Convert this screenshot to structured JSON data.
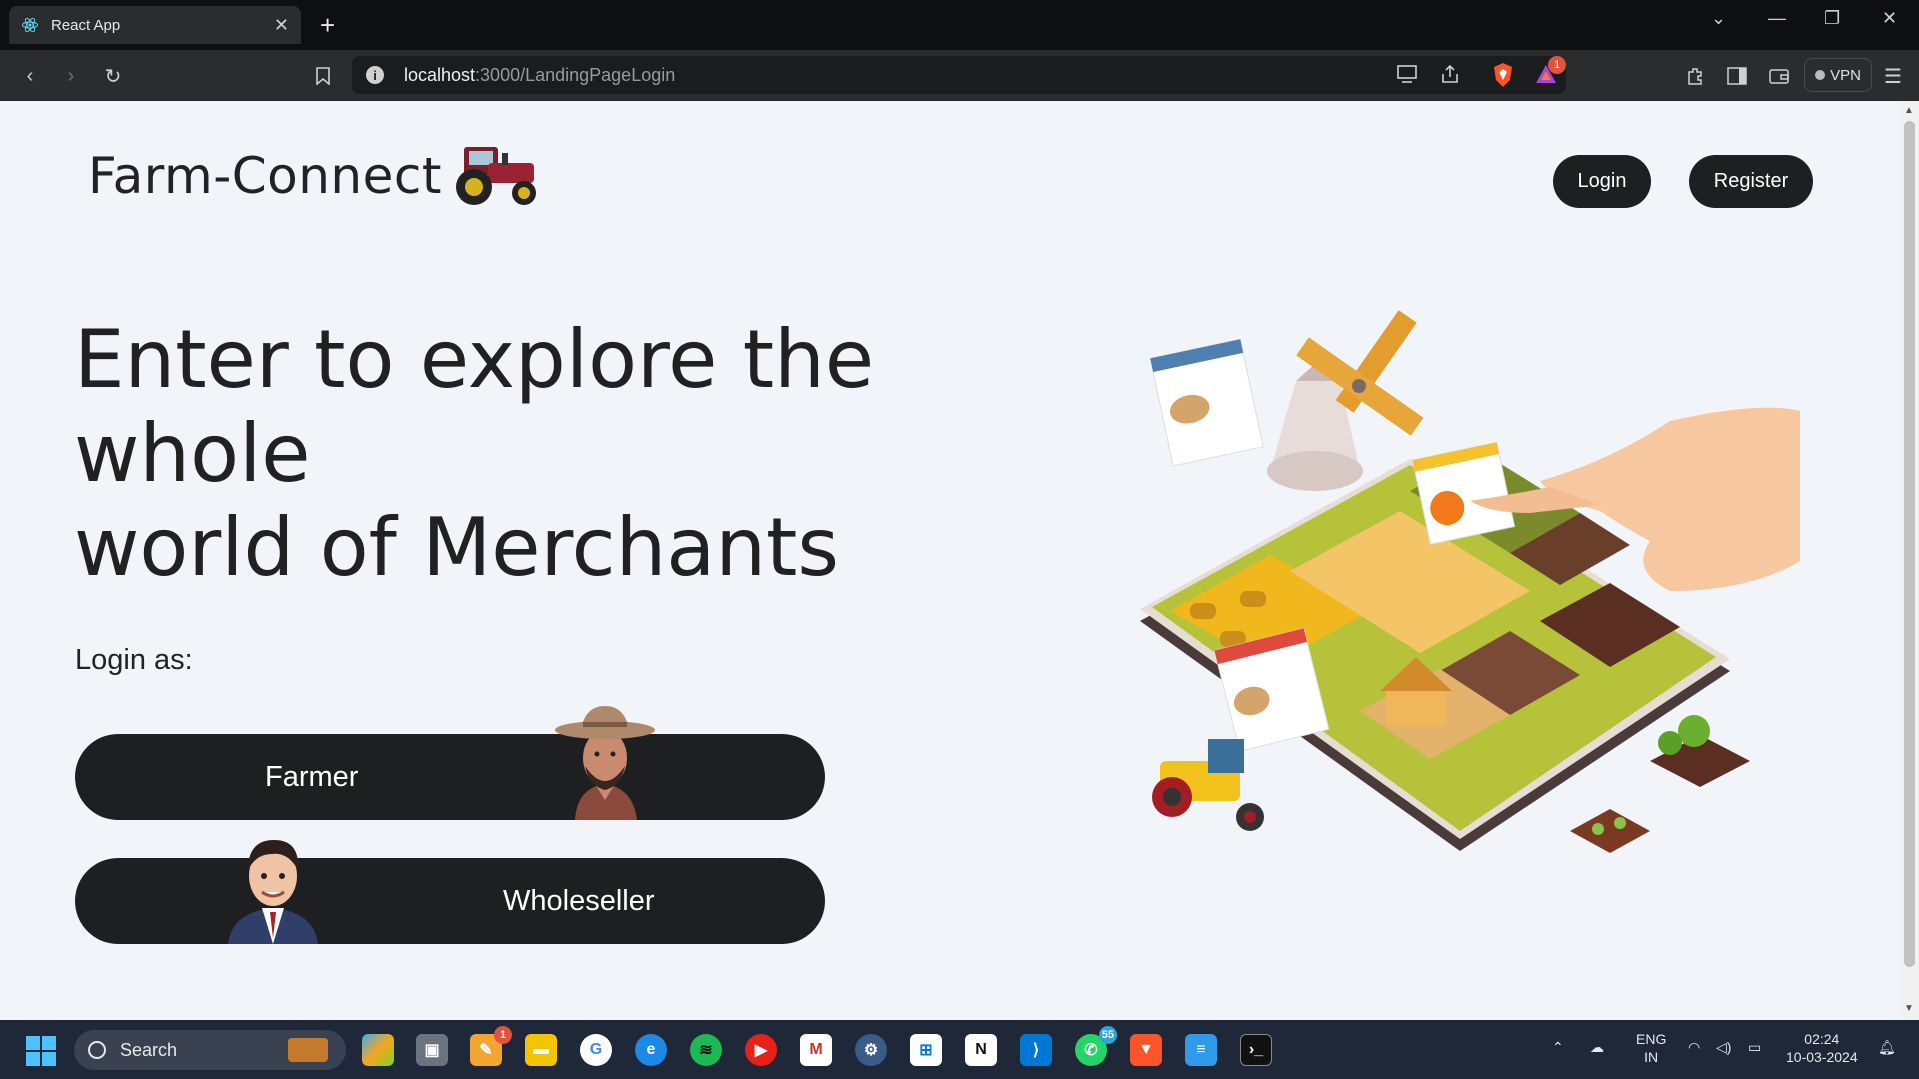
{
  "browser": {
    "tab_title": "React App",
    "url_host": "localhost",
    "url_path": ":3000/LandingPageLogin",
    "vpn_label": "VPN",
    "shield_badge": "1"
  },
  "page": {
    "brand": "Farm-Connect",
    "nav": {
      "login": "Login",
      "register": "Register"
    },
    "hero_line1": "Enter to explore the whole",
    "hero_line2": "world of Merchants",
    "login_as": "Login as:",
    "roles": {
      "farmer": "Farmer",
      "wholeseller": "Wholeseller"
    }
  },
  "taskbar": {
    "search_label": "Search",
    "lang_top": "ENG",
    "lang_bottom": "IN",
    "time": "02:24",
    "date": "10-03-2024",
    "badges": {
      "notes": "1",
      "whatsapp": "55"
    }
  },
  "colors": {
    "page_bg": "#f1f4f9",
    "button_bg": "#1e1f21",
    "taskbar_bg": "#1f2838",
    "browser_toolbar": "#2b2c2e"
  }
}
